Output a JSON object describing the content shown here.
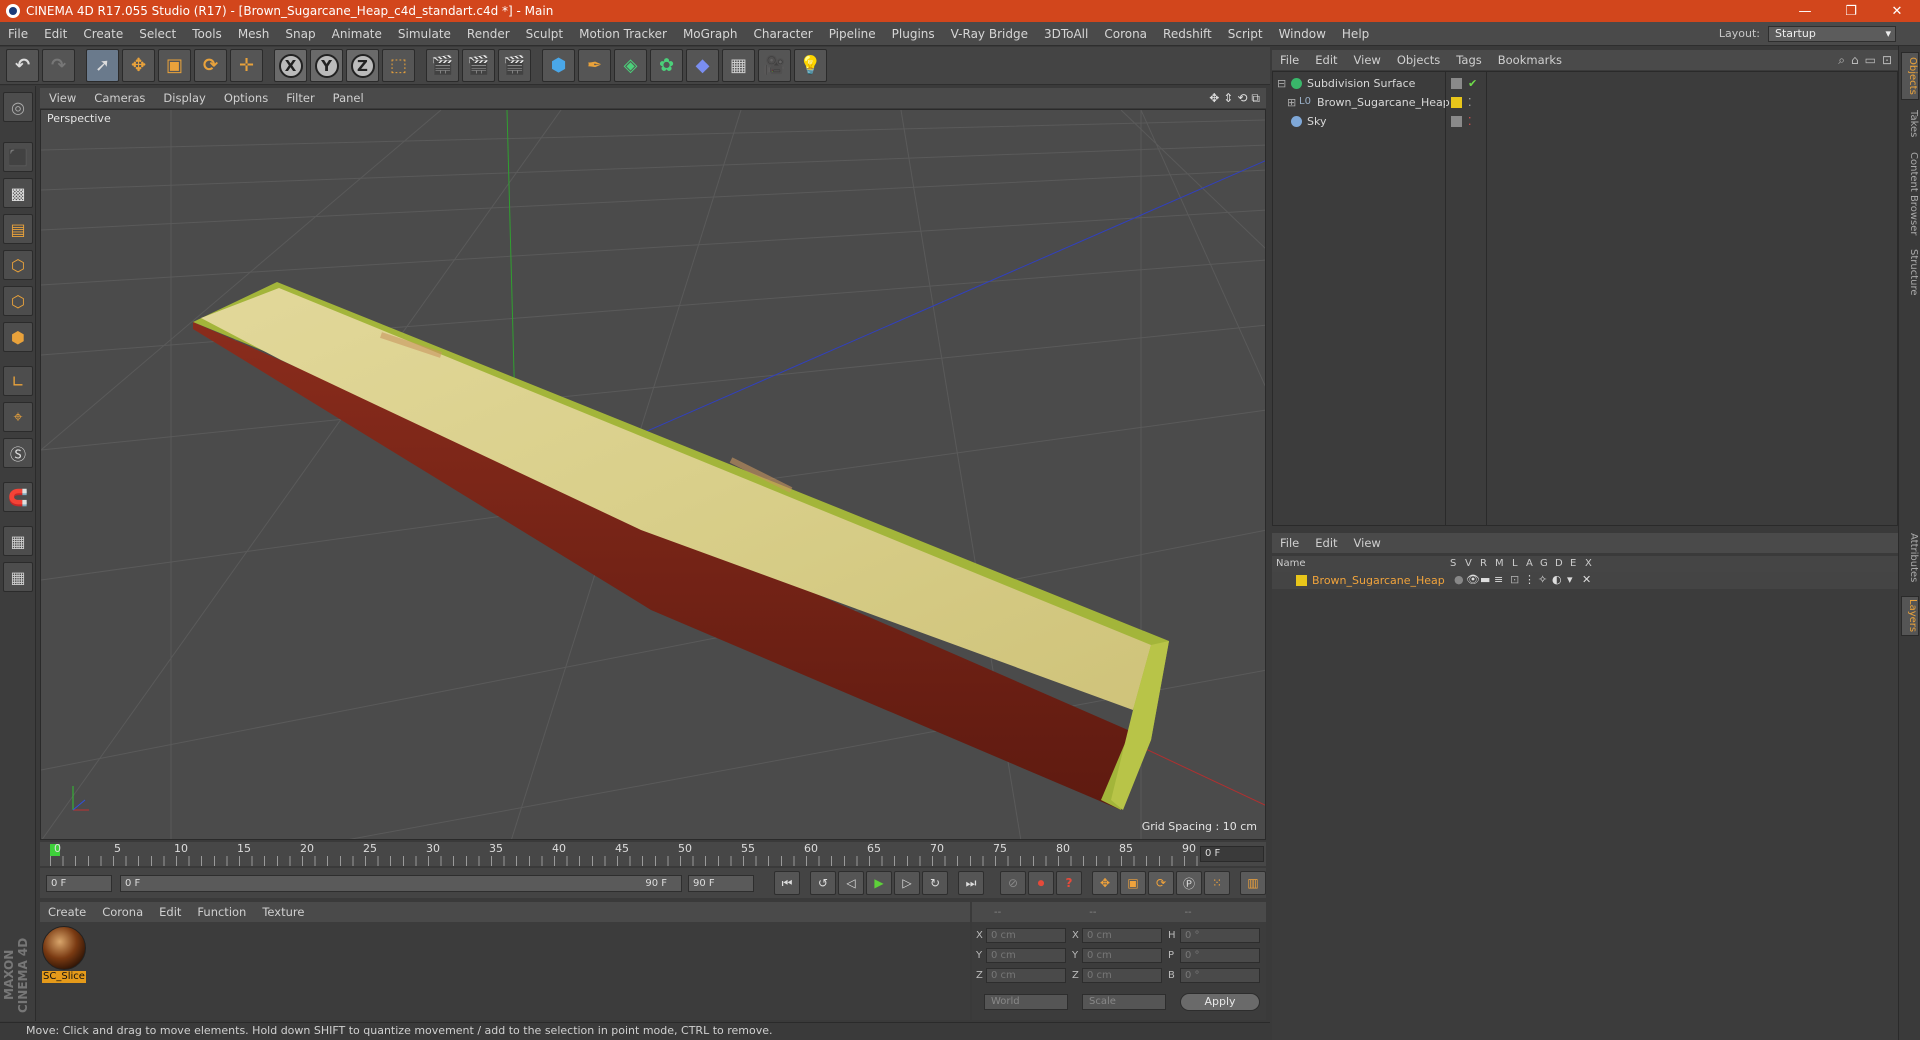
{
  "window": {
    "title": "CINEMA 4D R17.055 Studio (R17) - [Brown_Sugarcane_Heap_c4d_standart.c4d *] - Main",
    "controls": [
      "—",
      "❐",
      "✕"
    ]
  },
  "menubar": {
    "items": [
      "File",
      "Edit",
      "Create",
      "Select",
      "Tools",
      "Mesh",
      "Snap",
      "Animate",
      "Simulate",
      "Render",
      "Sculpt",
      "Motion Tracker",
      "MoGraph",
      "Character",
      "Pipeline",
      "Plugins",
      "V-Ray Bridge",
      "3DToAll",
      "Corona",
      "Redshift",
      "Script",
      "Window",
      "Help"
    ],
    "layout_label": "Layout:",
    "layout_value": "Startup"
  },
  "toolbar": {
    "axis_x": "X",
    "axis_y": "Y",
    "axis_z": "Z"
  },
  "viewport": {
    "menu": [
      "View",
      "Cameras",
      "Display",
      "Options",
      "Filter",
      "Panel"
    ],
    "camera_label": "Perspective",
    "grid_spacing": "Grid Spacing : 10 cm",
    "colors": {
      "bg": "#4b4b4b",
      "grid": "#5a5a5a",
      "x_axis": "#b03030",
      "y_axis": "#30a030",
      "z_axis": "#3040c0",
      "wood_top": "#d9cf8a",
      "wood_edge": "#a3b53a",
      "wood_side": "#7a2418"
    }
  },
  "timeline": {
    "frames": [
      "0",
      "5",
      "10",
      "15",
      "20",
      "25",
      "30",
      "35",
      "40",
      "45",
      "50",
      "55",
      "60",
      "65",
      "70",
      "75",
      "80",
      "85",
      "90"
    ],
    "current": "0 F"
  },
  "playback": {
    "start": "0 F",
    "range_left": "0 F",
    "range_right": "90 F",
    "end": "90 F"
  },
  "material_manager": {
    "menu": [
      "Create",
      "Corona",
      "Edit",
      "Function",
      "Texture"
    ],
    "material_name": "SC_Slice"
  },
  "coordinates": {
    "headers": [
      "--",
      "--",
      "--"
    ],
    "rows": [
      {
        "l1": "X",
        "v1": "0 cm",
        "l2": "X",
        "v2": "0 cm",
        "l3": "H",
        "v3": "0 °"
      },
      {
        "l1": "Y",
        "v1": "0 cm",
        "l2": "Y",
        "v2": "0 cm",
        "l3": "P",
        "v3": "0 °"
      },
      {
        "l1": "Z",
        "v1": "0 cm",
        "l2": "Z",
        "v2": "0 cm",
        "l3": "B",
        "v3": "0 °"
      }
    ],
    "space": "World",
    "mode": "Scale",
    "apply": "Apply"
  },
  "status": "Move: Click and drag to move elements. Hold down SHIFT to quantize movement / add to the selection in point mode, CTRL to remove.",
  "brand": "MAXON CINEMA 4D",
  "object_manager": {
    "menu": [
      "File",
      "Edit",
      "View",
      "Objects",
      "Tags",
      "Bookmarks"
    ],
    "objects": [
      {
        "name": "Subdivision Surface",
        "icon_color": "#39b76a",
        "indent": 0
      },
      {
        "name": "Brown_Sugarcane_Heap",
        "icon_color": "#9ab0c8",
        "indent": 1,
        "prefix": "L0"
      },
      {
        "name": "Sky",
        "icon_color": "#7fa8d8",
        "indent": 0
      }
    ]
  },
  "layer_manager": {
    "menu": [
      "File",
      "Edit",
      "View"
    ],
    "columns": [
      "Name",
      "S",
      "V",
      "R",
      "M",
      "L",
      "A",
      "G",
      "D",
      "E",
      "X"
    ],
    "layers": [
      {
        "name": "Brown_Sugarcane_Heap",
        "color": "#e8c61a"
      }
    ]
  },
  "side_tabs": [
    "Objects",
    "Takes",
    "Content Browser",
    "Structure",
    "Attributes",
    "Layers"
  ]
}
